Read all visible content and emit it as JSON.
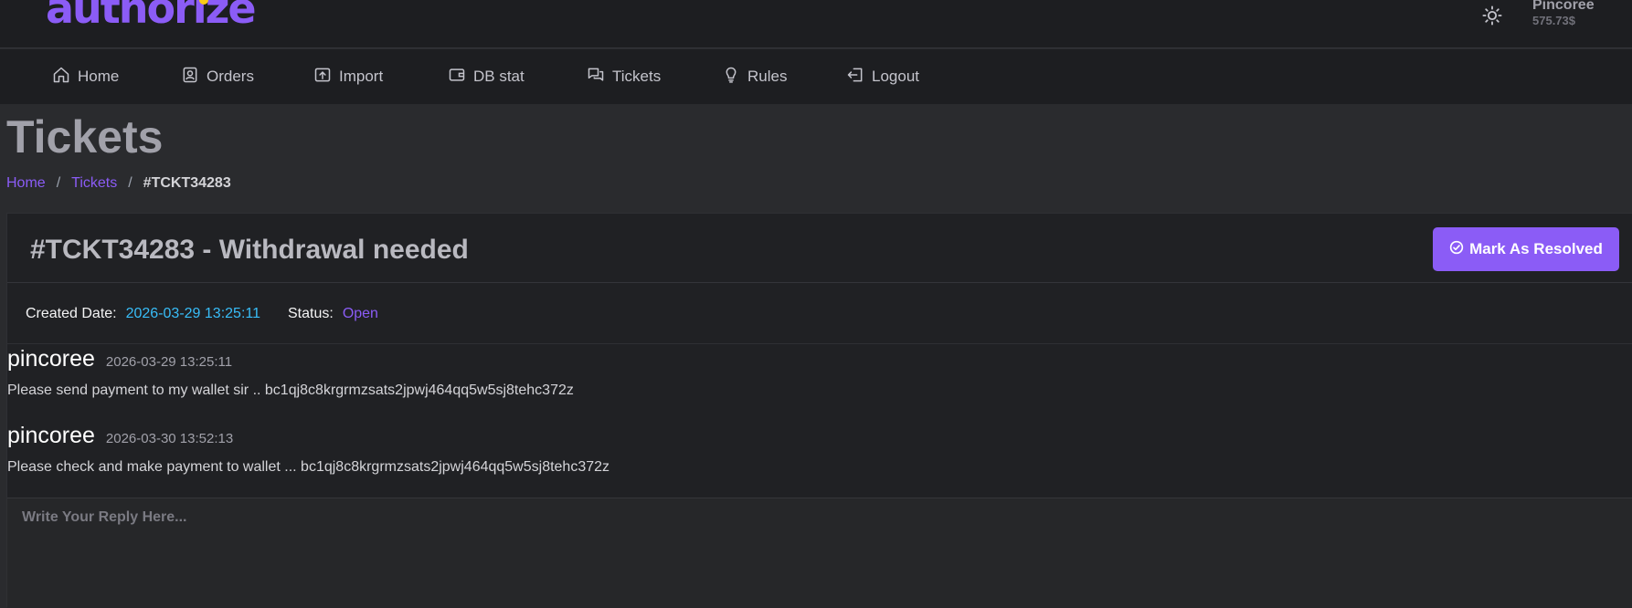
{
  "header": {
    "logo_text": "authorize",
    "theme_icon": "sun-icon",
    "user": {
      "name": "Pincoree",
      "balance": "575.73$"
    }
  },
  "nav": {
    "items": [
      {
        "label": "Home",
        "icon": "home-icon"
      },
      {
        "label": "Orders",
        "icon": "orders-icon"
      },
      {
        "label": "Import",
        "icon": "import-icon"
      },
      {
        "label": "DB stat",
        "icon": "wallet-icon"
      },
      {
        "label": "Tickets",
        "icon": "chat-icon"
      },
      {
        "label": "Rules",
        "icon": "lightbulb-icon"
      },
      {
        "label": "Logout",
        "icon": "logout-icon"
      }
    ]
  },
  "page": {
    "title": "Tickets",
    "breadcrumb": [
      {
        "label": "Home"
      },
      {
        "label": "Tickets"
      },
      {
        "label": "#TCKT34283"
      }
    ],
    "breadcrumb_separator": "/"
  },
  "ticket": {
    "title": "#TCKT34283 - Withdrawal needed",
    "resolve_button_label": "Mark As Resolved",
    "created_label": "Created Date:",
    "created_value": "2026-03-29 13:25:11",
    "status_label": "Status:",
    "status_value": "Open",
    "messages": [
      {
        "author": "pincoree",
        "time": "2026-03-29 13:25:11",
        "text": "Please send payment to my wallet sir .. bc1qj8c8krgrmzsats2jpwj464qq5w5sj8tehc372z"
      },
      {
        "author": "pincoree",
        "time": "2026-03-30 13:52:13",
        "text": "Please check and make payment to wallet ... bc1qj8c8krgrmzsats2jpwj464qq5w5sj8tehc372z"
      }
    ],
    "reply_placeholder": "Write Your Reply Here..."
  },
  "colors": {
    "accent": "#8b5cf6",
    "date_blue": "#38bdf8",
    "background": "#2a2b2e",
    "panel": "#1d1e21"
  }
}
